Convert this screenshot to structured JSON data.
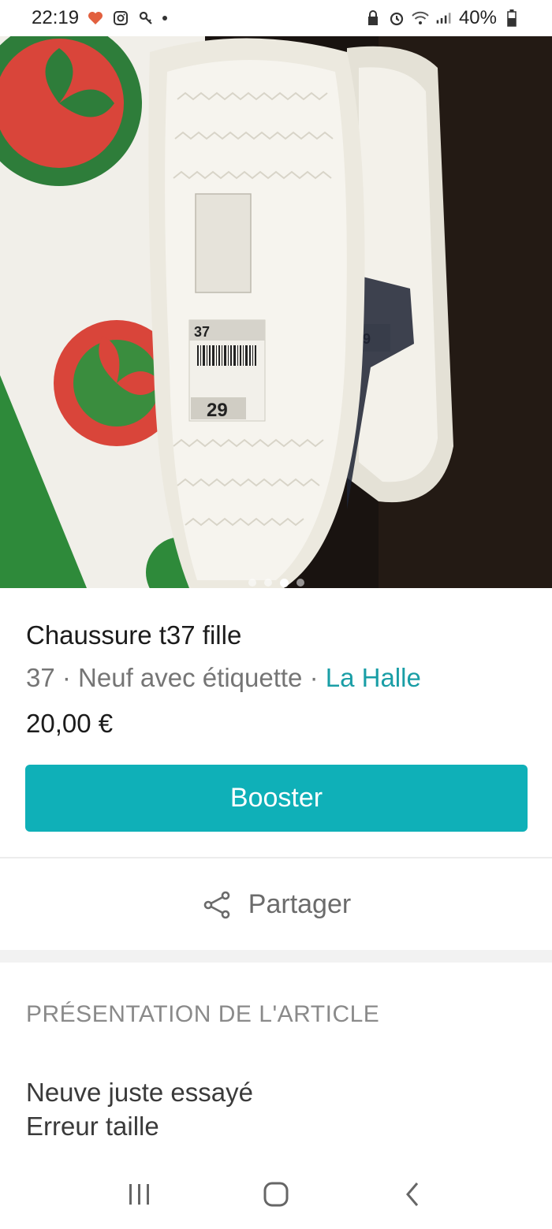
{
  "status_bar": {
    "time": "22:19",
    "battery": "40%",
    "left_icons": [
      "heart-notification-icon",
      "instagram-icon",
      "key-icon",
      "dot-icon"
    ],
    "right_icons": [
      "lock-icon",
      "alarm-icon",
      "wifi-icon",
      "signal-icon",
      "battery-icon"
    ]
  },
  "gallery": {
    "image_count": 4,
    "active_index": 2
  },
  "item": {
    "title": "Chaussure t37 fille",
    "size": "37",
    "separator": " · ",
    "condition": "Neuf avec étiquette",
    "brand": "La Halle",
    "price": "20,00 €"
  },
  "actions": {
    "booster_label": "Booster",
    "share_label": "Partager"
  },
  "presentation": {
    "heading": "PRÉSENTATION DE L'ARTICLE",
    "lines": [
      "Neuve juste essayé",
      "Erreur taille"
    ]
  },
  "colors": {
    "accent": "#0fb0b8",
    "brand_link": "#1a9ea6"
  },
  "nav": {
    "icons": [
      "recent-apps-icon",
      "home-icon",
      "back-icon"
    ]
  }
}
